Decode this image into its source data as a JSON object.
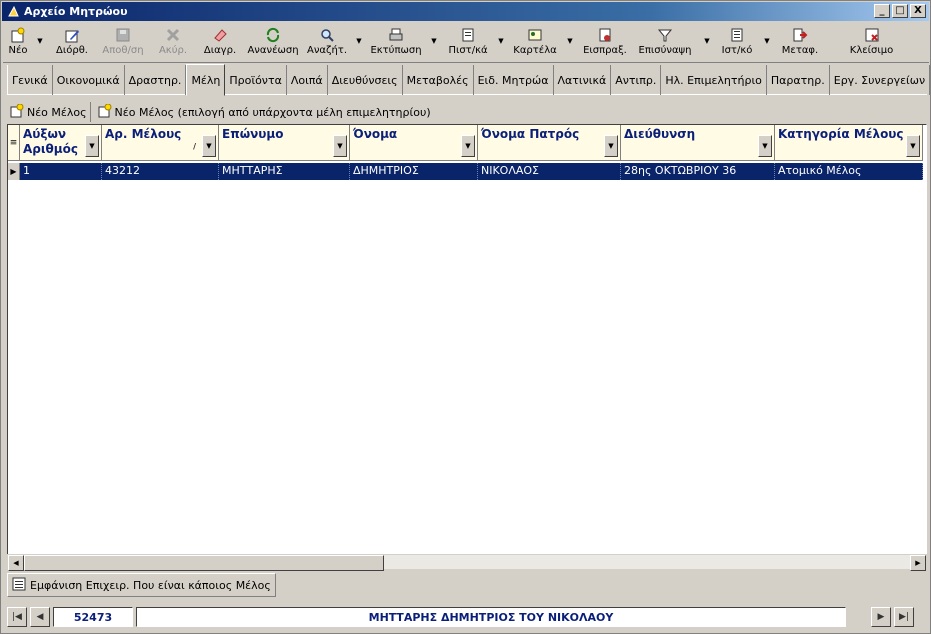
{
  "window": {
    "title": "Αρχείο Μητρώου",
    "minimize": "_",
    "maximize": "□",
    "close": "X"
  },
  "toolbar": {
    "new": "Νέο",
    "edit": "Διόρθ.",
    "save": "Αποθ/ση",
    "cancel": "Ακύρ.",
    "delete": "Διαγρ.",
    "refresh": "Ανανέωση",
    "search": "Αναζήτ.",
    "print": "Εκτύπωση",
    "certificate": "Πιστ/κά",
    "card": "Καρτέλα",
    "receipt": "Εισπραξ.",
    "summary": "Επισύναψη",
    "history": "Ιστ/κό",
    "transfer": "Μεταφ.",
    "close": "Κλείσιμο"
  },
  "tabs": [
    "Γενικά",
    "Οικονομικά",
    "Δραστηρ.",
    "Μέλη",
    "Προϊόντα",
    "Λοιπά",
    "Διευθύνσεις",
    "Μεταβολές",
    "Ειδ. Μητρώα",
    "Λατινικά",
    "Αντιπρ.",
    "Ηλ. Επιμελητήριο",
    "Παρατηρ.",
    "Εργ. Συνεργείων"
  ],
  "active_tab": "Μέλη",
  "subbar": {
    "new_member": "Νέο Μέλος",
    "new_member_existing": "Νέο Μέλος (επιλογή από υπάρχοντα μέλη επιμελητηρίου)"
  },
  "grid": {
    "headers": {
      "serial_l1": "Αύξων",
      "serial_l2": "Αριθμός",
      "member_no": "Αρ. Μέλους",
      "surname": "Επώνυμο",
      "name": "Όνομα",
      "father": "Όνομα Πατρός",
      "address": "Διεύθυνση",
      "category": "Κατηγορία Μέλους"
    },
    "row": {
      "serial": "1",
      "member_no": "43212",
      "surname": "ΜΗΤΤΑΡΗΣ",
      "name": "ΔΗΜΗΤΡΙΟΣ",
      "father": "ΝΙΚΟΛΑΟΣ",
      "address": "28ης ΟΚΤΩΒΡΙΟΥ 36",
      "category": "Ατομικό Μέλος"
    }
  },
  "bottom_button": "Εμφάνιση Επιχειρ. Που είναι κάποιος Μέλος",
  "nav": {
    "record_id": "52473",
    "record_name": "ΜΗΤΤΑΡΗΣ ΔΗΜΗΤΡΙΟΣ ΤΟΥ ΝΙΚΟΛΑΟΥ"
  }
}
